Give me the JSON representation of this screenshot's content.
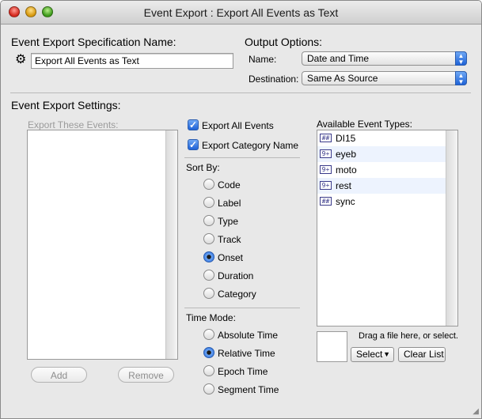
{
  "window": {
    "title": "Event Export : Export All Events as Text"
  },
  "spec": {
    "heading": "Event Export Specification Name:",
    "value": "Export All Events as Text"
  },
  "output": {
    "heading": "Output Options:",
    "name_label": "Name:",
    "name_value": "Date and Time",
    "destination_label": "Destination:",
    "destination_value": "Same As Source"
  },
  "settings": {
    "heading": "Event Export Settings:",
    "export_these_label": "Export These Events:",
    "add_label": "Add",
    "remove_label": "Remove"
  },
  "options": {
    "export_all_label": "Export All Events",
    "export_all_checked": true,
    "export_category_label": "Export Category Name",
    "export_category_checked": true
  },
  "sort_by": {
    "heading": "Sort By:",
    "options": [
      "Code",
      "Label",
      "Type",
      "Track",
      "Onset",
      "Duration",
      "Category"
    ],
    "selected": "Onset"
  },
  "time_mode": {
    "heading": "Time Mode:",
    "options": [
      "Absolute Time",
      "Relative Time",
      "Epoch Time",
      "Segment Time"
    ],
    "selected": "Relative Time"
  },
  "event_types": {
    "heading": "Available Event Types:",
    "items": [
      {
        "name": "DI15",
        "icon": "event-type-grid-icon"
      },
      {
        "name": "eyeb",
        "icon": "event-type-flag-icon"
      },
      {
        "name": "moto",
        "icon": "event-type-flag-icon"
      },
      {
        "name": "rest",
        "icon": "event-type-flag-icon"
      },
      {
        "name": "sync",
        "icon": "event-type-grid-icon"
      }
    ]
  },
  "file": {
    "drag_text": "Drag a file here, or select.",
    "select_label": "Select",
    "clear_label": "Clear List"
  },
  "colors": {
    "accent": "#1f62d6",
    "alternate_row": "#edf3fe"
  }
}
